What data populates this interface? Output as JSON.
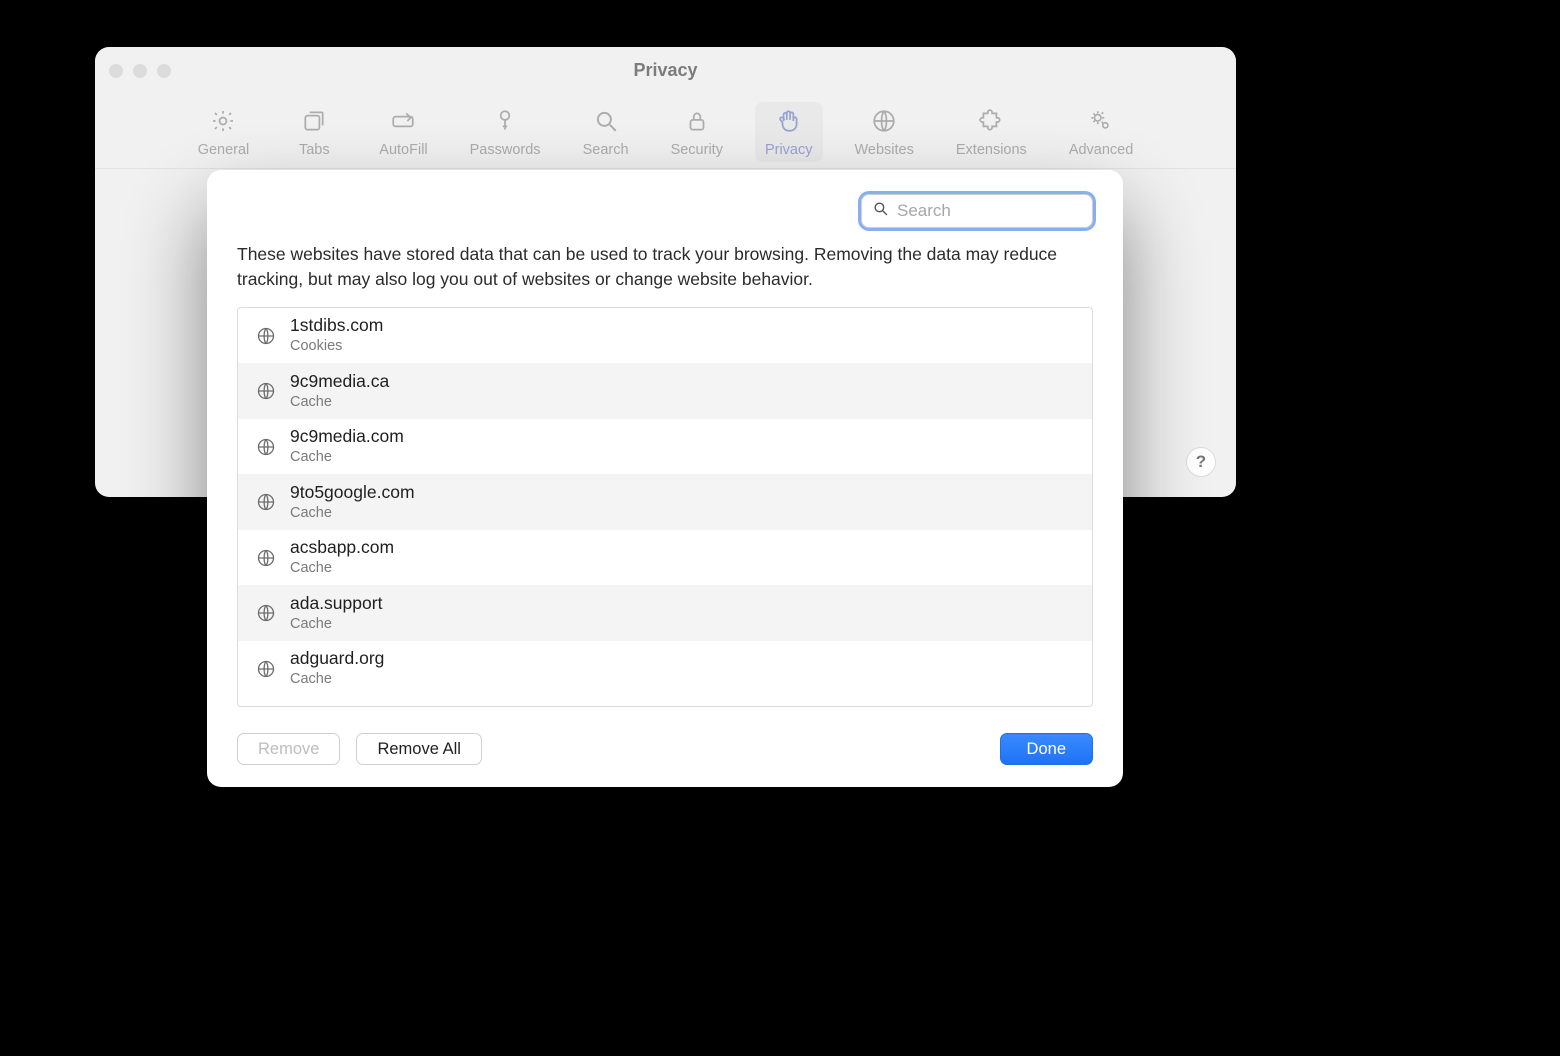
{
  "window": {
    "title": "Privacy"
  },
  "toolbar": {
    "items": [
      {
        "label": "General"
      },
      {
        "label": "Tabs"
      },
      {
        "label": "AutoFill"
      },
      {
        "label": "Passwords"
      },
      {
        "label": "Search"
      },
      {
        "label": "Security"
      },
      {
        "label": "Privacy"
      },
      {
        "label": "Websites"
      },
      {
        "label": "Extensions"
      },
      {
        "label": "Advanced"
      }
    ]
  },
  "help": {
    "label": "?"
  },
  "sheet": {
    "search": {
      "placeholder": "Search"
    },
    "description": "These websites have stored data that can be used to track your browsing. Removing the data may reduce tracking, but may also log you out of websites or change website behavior.",
    "sites": [
      {
        "domain": "1stdibs.com",
        "kind": "Cookies"
      },
      {
        "domain": "9c9media.ca",
        "kind": "Cache"
      },
      {
        "domain": "9c9media.com",
        "kind": "Cache"
      },
      {
        "domain": "9to5google.com",
        "kind": "Cache"
      },
      {
        "domain": "acsbapp.com",
        "kind": "Cache"
      },
      {
        "domain": "ada.support",
        "kind": "Cache"
      },
      {
        "domain": "adguard.org",
        "kind": "Cache"
      }
    ],
    "buttons": {
      "remove": "Remove",
      "remove_all": "Remove All",
      "done": "Done"
    }
  }
}
